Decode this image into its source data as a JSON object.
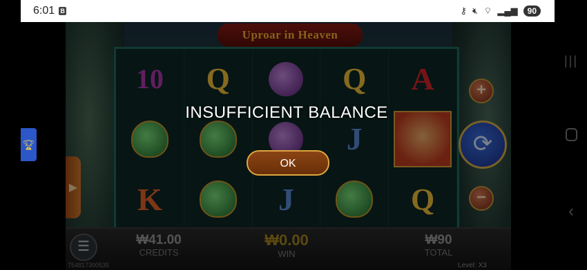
{
  "status_bar": {
    "time": "6:01",
    "b_icon": "B",
    "battery": "90"
  },
  "game": {
    "logo_text": "Uproar in Heaven",
    "reels": [
      [
        "10",
        "urn",
        "K"
      ],
      [
        "Q",
        "urn",
        "urn"
      ],
      [
        "orb",
        "orb",
        "J"
      ],
      [
        "Q",
        "J",
        "urn"
      ],
      [
        "A",
        "monkey",
        "Q"
      ]
    ],
    "controls": {
      "plus": "+",
      "minus": "−",
      "spin": "⟳",
      "left_arrow": "▶"
    },
    "menu_icon": "☰",
    "credits": {
      "amount": "₩41.00",
      "label": "CREDITS"
    },
    "win": {
      "amount": "₩0.00",
      "label": "WIN"
    },
    "total": {
      "amount": "₩90",
      "label": "TOTAL"
    },
    "round_id": "754817300535",
    "level": "Level: X3"
  },
  "dialog": {
    "message": "INSUFFICIENT BALANCE",
    "ok_label": "OK"
  },
  "side_widget_icon": "trophy-icon"
}
